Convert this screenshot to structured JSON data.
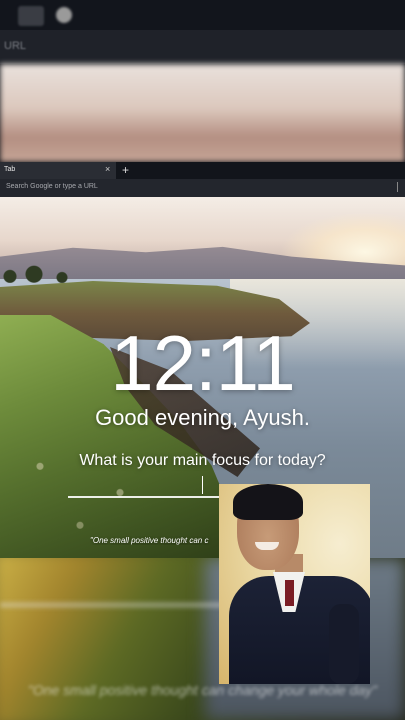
{
  "blurred_browser": {
    "url_placeholder": "URL"
  },
  "browser": {
    "tab_label": "Tab",
    "close_glyph": "×",
    "new_tab_glyph": "+",
    "omnibox_placeholder": "Search Google or type a URL"
  },
  "dashboard": {
    "clock": "12:11",
    "greeting": "Good evening, Ayush.",
    "focus_question": "What is your main focus for today?",
    "focus_value": "",
    "quote": "\"One small positive thought can c"
  },
  "bottom_mirror": {
    "quote_blurred": "\"One small positive thought can change your whole day\""
  },
  "colors": {
    "tab_bg": "#2a2d34",
    "omnibox_bg": "#23262d",
    "text": "#ffffff"
  },
  "icons": {
    "search": "search-icon",
    "webcam": "webcam-feed"
  }
}
